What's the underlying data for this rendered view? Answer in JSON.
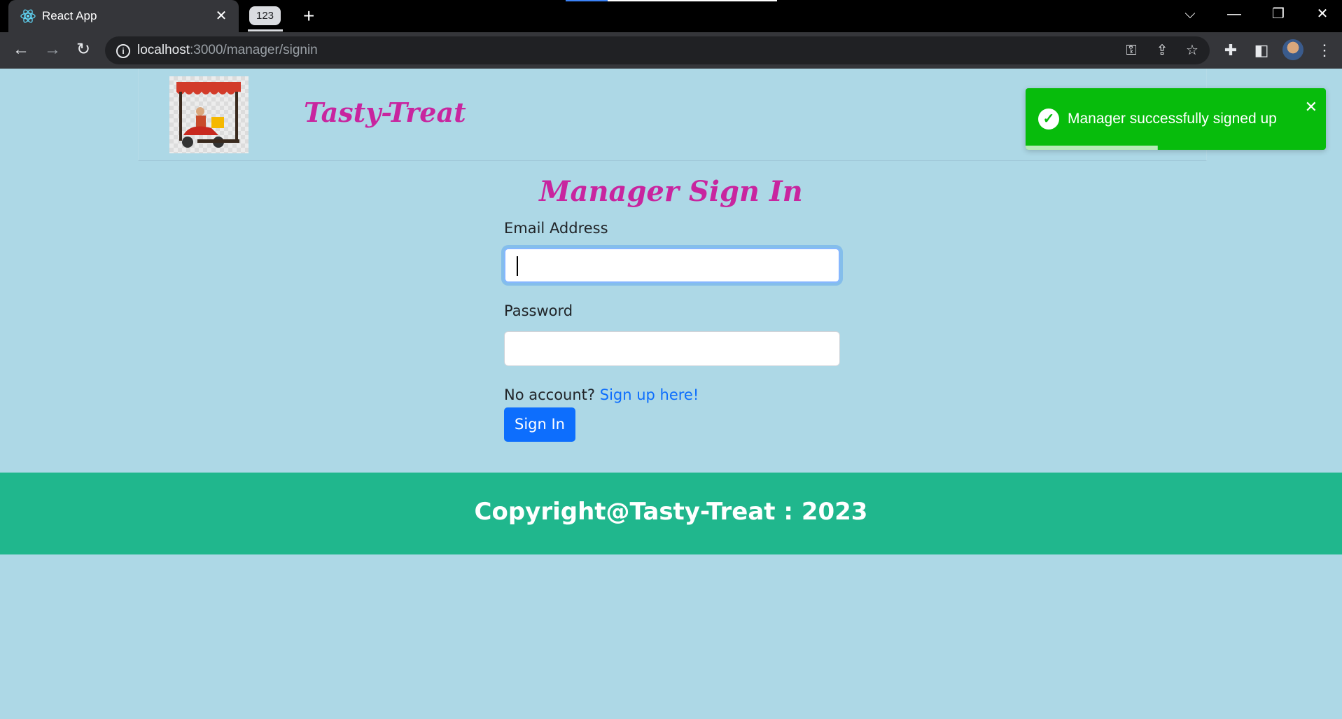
{
  "browser": {
    "tab_title": "React App",
    "tab_group_label": "123",
    "url_host": "localhost",
    "url_path": ":3000/manager/signin"
  },
  "header": {
    "brand": "Tasty-Treat",
    "logo_alt": "Food Delivery"
  },
  "toast": {
    "message": "Manager successfully signed up",
    "progress_remaining": 0.44
  },
  "form": {
    "title": "Manager Sign In",
    "email_label": "Email Address",
    "email_value": "",
    "password_label": "Password",
    "password_value": "",
    "no_account_text": "No account?",
    "signup_link": "Sign up here!",
    "submit_label": "Sign In"
  },
  "footer": {
    "copyright": "Copyright@Tasty-Treat : 2023"
  },
  "colors": {
    "page_bg": "#add8e6",
    "brand": "#c8259f",
    "toast_bg": "#07bc0c",
    "footer_bg": "#20b78d",
    "button": "#0d6efd"
  }
}
